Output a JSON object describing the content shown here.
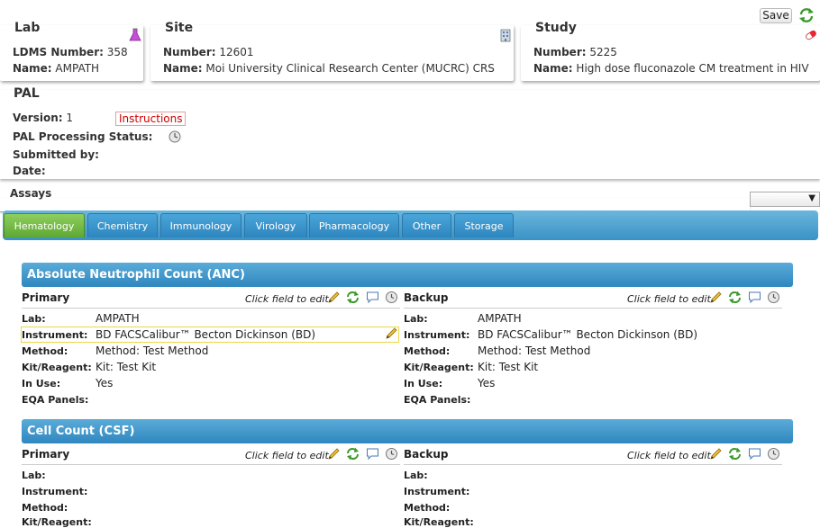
{
  "toolbar": {
    "save_label": "Save"
  },
  "lab": {
    "title": "Lab",
    "ldms_label": "LDMS Number:",
    "ldms_value": "358",
    "name_label": "Name:",
    "name_value": "AMPATH"
  },
  "site": {
    "title": "Site",
    "number_label": "Number:",
    "number_value": "12601",
    "name_label": "Name:",
    "name_value": "Moi University Clinical Research Center (MUCRC) CRS"
  },
  "study": {
    "title": "Study",
    "number_label": "Number:",
    "number_value": "5225",
    "name_label": "Name:",
    "name_value": "High dose fluconazole CM treatment in HIV"
  },
  "pal": {
    "title": "PAL",
    "version_label": "Version:",
    "version_value": "1",
    "instructions_label": "Instructions",
    "status_label": "PAL Processing Status:",
    "submitted_label": "Submitted by:",
    "date_label": "Date:"
  },
  "assays": {
    "label": "Assays",
    "select_value": ""
  },
  "tabs": [
    "Hematology",
    "Chemistry",
    "Immunology",
    "Virology",
    "Pharmacology",
    "Other",
    "Storage"
  ],
  "sections": [
    {
      "title": "Absolute Neutrophil Count (ANC)",
      "primary": {
        "title": "Primary",
        "hint": "Click field to edit.",
        "fields": [
          {
            "label": "Lab:",
            "value": "AMPATH"
          },
          {
            "label": "Instrument:",
            "value": "BD FACSCalibur™ Becton Dickinson (BD)"
          },
          {
            "label": "Method:",
            "value": "Method: Test Method"
          },
          {
            "label": "Kit/Reagent:",
            "value": "Kit: Test Kit"
          },
          {
            "label": "In Use:",
            "value": "Yes"
          },
          {
            "label": "EQA Panels:",
            "value": ""
          }
        ]
      },
      "backup": {
        "title": "Backup",
        "hint": "Click field to edit.",
        "fields": [
          {
            "label": "Lab:",
            "value": "AMPATH"
          },
          {
            "label": "Instrument:",
            "value": "BD FACSCalibur™ Becton Dickinson (BD)"
          },
          {
            "label": "Method:",
            "value": "Method: Test Method"
          },
          {
            "label": "Kit/Reagent:",
            "value": "Kit: Test Kit"
          },
          {
            "label": "In Use:",
            "value": "Yes"
          },
          {
            "label": "EQA Panels:",
            "value": ""
          }
        ]
      }
    },
    {
      "title": "Cell Count (CSF)",
      "primary": {
        "title": "Primary",
        "hint": "Click field to edit.",
        "fields": [
          {
            "label": "Lab:",
            "value": ""
          },
          {
            "label": "Instrument:",
            "value": ""
          },
          {
            "label": "Method:",
            "value": ""
          },
          {
            "label": "Kit/Reagent:",
            "value": ""
          }
        ]
      },
      "backup": {
        "title": "Backup",
        "hint": "Click field to edit.",
        "fields": [
          {
            "label": "Lab:",
            "value": ""
          },
          {
            "label": "Instrument:",
            "value": ""
          },
          {
            "label": "Method:",
            "value": ""
          },
          {
            "label": "Kit/Reagent:",
            "value": ""
          }
        ]
      }
    }
  ]
}
